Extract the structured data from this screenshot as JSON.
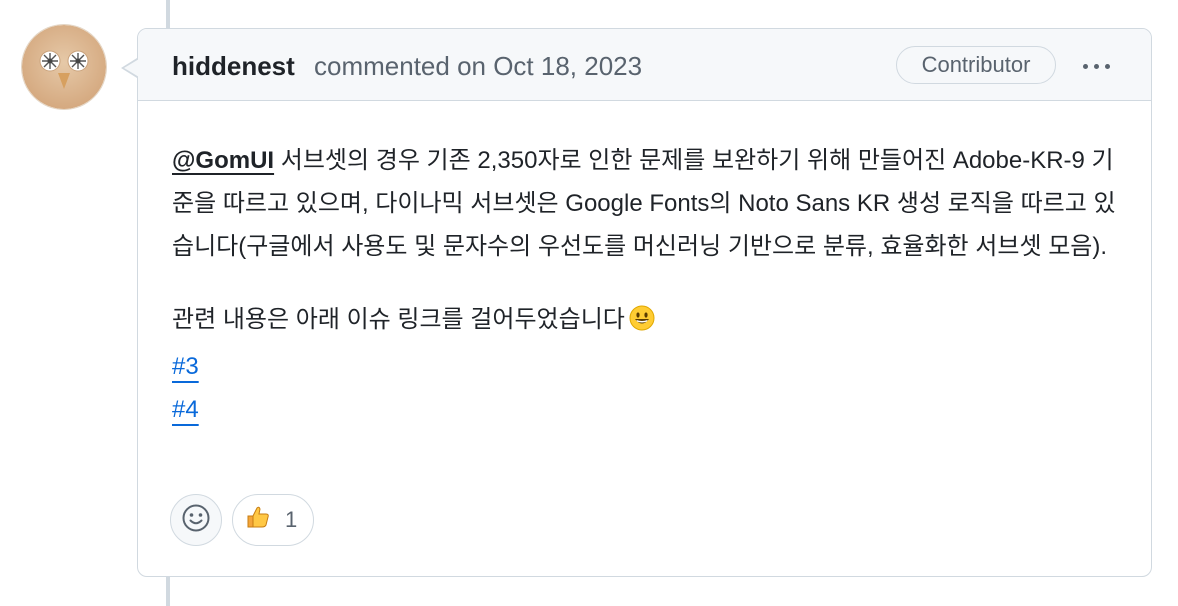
{
  "comment": {
    "author": "hiddenest",
    "meta": "commented on Oct 18, 2023",
    "role_badge": "Contributor",
    "body": {
      "mention": "@GomUI",
      "paragraph1_rest": " 서브셋의 경우 기존 2,350자로 인한 문제를 보완하기 위해 만들어진 Adobe-KR-9 기준을 따르고 있으며, 다이나믹 서브셋은 Google Fonts의 Noto Sans KR 생성 로직을 따르고 있습니다(구글에서 사용도 및 문자수의 우선도를 머신러닝 기반으로 분류, 효율화한 서브셋 모음).",
      "paragraph2": "관련 내용은 아래 이슈 링크를 걸어두었습니다",
      "links": [
        "#3",
        "#4"
      ]
    },
    "reactions": [
      {
        "emoji": "thumbs-up",
        "count": "1"
      }
    ]
  },
  "icons": {
    "more": "kebab-horizontal-icon",
    "add_reaction": "smiley-icon",
    "emoji_in_text": "grinning-face-emoji"
  }
}
